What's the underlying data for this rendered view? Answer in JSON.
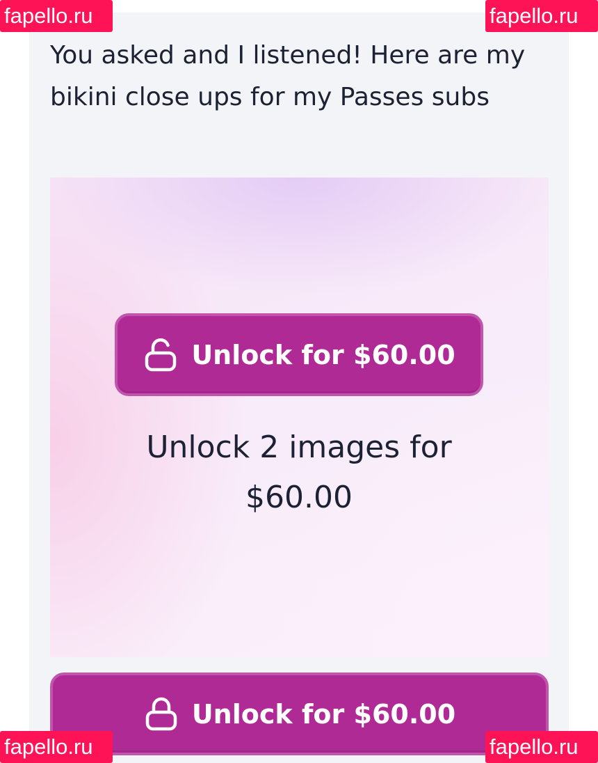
{
  "post": {
    "caption": "You asked and I listened! Here are my bikini close ups for my Passes subs"
  },
  "media": {
    "unlock_button_label": "Unlock for $60.00",
    "unlock_button_icon": "unlock-icon",
    "unlock_description": "Unlock 2 images for $60.00"
  },
  "footer": {
    "unlock_button_label": "Unlock for $60.00",
    "unlock_button_icon": "lock-icon"
  },
  "watermarks": {
    "top_left": "fapello.ru",
    "top_right": "fapello.ru",
    "bottom_left": "fapello.ru",
    "bottom_right": "fapello.ru"
  },
  "colors": {
    "button_bg": "#b02a96",
    "button_border": "#c055ab",
    "text": "#1c2233",
    "card_bg": "#f3f4f7",
    "watermark_bg": "#ff1357"
  }
}
